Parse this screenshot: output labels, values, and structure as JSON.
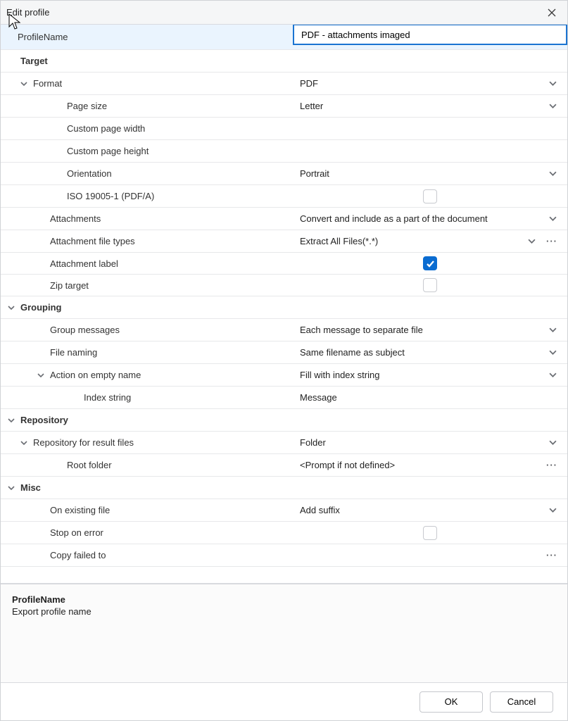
{
  "window": {
    "title": "Edit profile"
  },
  "profile_name": {
    "label": "ProfileName",
    "value": "PDF - attachments imaged"
  },
  "sections": {
    "target": {
      "title": "Target",
      "format": {
        "label": "Format",
        "value": "PDF"
      },
      "page_size": {
        "label": "Page size",
        "value": "Letter"
      },
      "custom_page_width": {
        "label": "Custom page width",
        "value": ""
      },
      "custom_page_height": {
        "label": "Custom page height",
        "value": ""
      },
      "orientation": {
        "label": "Orientation",
        "value": "Portrait"
      },
      "iso_pdfa": {
        "label": "ISO 19005-1 (PDF/A)",
        "checked": false
      },
      "attachments": {
        "label": "Attachments",
        "value": "Convert and include as a part of the document"
      },
      "attachment_file_types": {
        "label": "Attachment file types",
        "value": "Extract All Files(*.*)"
      },
      "attachment_label": {
        "label": "Attachment label",
        "checked": true
      },
      "zip_target": {
        "label": "Zip target",
        "checked": false
      }
    },
    "grouping": {
      "title": "Grouping",
      "group_messages": {
        "label": "Group messages",
        "value": "Each message to separate file"
      },
      "file_naming": {
        "label": "File naming",
        "value": "Same filename as subject"
      },
      "action_on_empty_name": {
        "label": "Action on empty name",
        "value": "Fill with index string"
      },
      "index_string": {
        "label": "Index string",
        "value": "Message"
      }
    },
    "repository": {
      "title": "Repository",
      "repository_for_result_files": {
        "label": "Repository for result files",
        "value": "Folder"
      },
      "root_folder": {
        "label": "Root folder",
        "value": "<Prompt if not defined>"
      }
    },
    "misc": {
      "title": "Misc",
      "on_existing_file": {
        "label": "On existing file",
        "value": "Add suffix"
      },
      "stop_on_error": {
        "label": "Stop on error",
        "checked": false
      },
      "copy_failed_to": {
        "label": "Copy failed to",
        "value": ""
      }
    }
  },
  "description": {
    "title": "ProfileName",
    "text": "Export profile name"
  },
  "buttons": {
    "ok": "OK",
    "cancel": "Cancel"
  }
}
